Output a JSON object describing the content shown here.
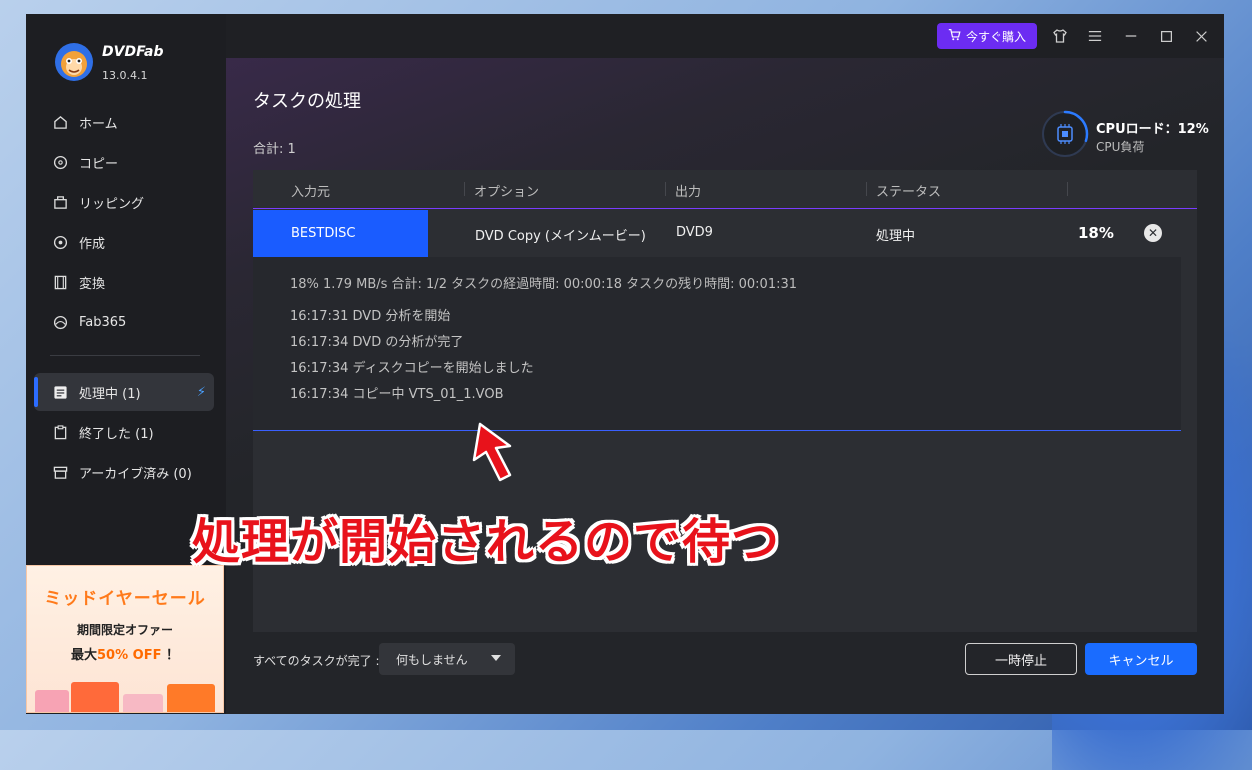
{
  "app": {
    "brand": "DVDFab",
    "version": "13.0.4.1"
  },
  "sidebar": {
    "items": [
      {
        "label": "ホーム",
        "icon": "home-icon"
      },
      {
        "label": "コピー",
        "icon": "copy-disc-icon"
      },
      {
        "label": "リッピング",
        "icon": "ripping-icon"
      },
      {
        "label": "作成",
        "icon": "create-disc-icon"
      },
      {
        "label": "変換",
        "icon": "film-icon"
      },
      {
        "label": "Fab365",
        "icon": "fab365-icon"
      }
    ],
    "queue": [
      {
        "label": "処理中 (1)",
        "icon": "task-list-icon",
        "active": true
      },
      {
        "label": "終了した (1)",
        "icon": "clipboard-icon",
        "active": false
      },
      {
        "label": "アーカイブ済み (0)",
        "icon": "archive-icon",
        "active": false
      }
    ]
  },
  "promo": {
    "title": "ミッドイヤーセール",
    "subtitle": "期間限定オファー",
    "offer_prefix": "最大",
    "offer_value": "50% OFF",
    "offer_suffix": "！"
  },
  "topbar": {
    "buy_label": "今すぐ購入"
  },
  "page": {
    "title": "タスクの処理",
    "total": "合計: 1"
  },
  "cpu": {
    "load_label": "CPUロード：12%",
    "sub_label": "CPU負荷",
    "load_fraction": 0.12,
    "accent": "#2c7bff"
  },
  "table": {
    "headers": [
      "入力元",
      "オプション",
      "出力",
      "ステータス"
    ],
    "row": {
      "source": "BESTDISC",
      "option": "DVD Copy (メインムービー)",
      "output": "DVD9",
      "status": "処理中",
      "percent": "18%"
    },
    "details": {
      "stats": "18%  1.79 MB/s   合計: 1/2  タスクの経過時間: 00:00:18  タスクの残り時間: 00:01:31",
      "log": [
        "16:17:31  DVD 分析を開始",
        "16:17:34  DVD の分析が完了",
        "16:17:34  ディスクコピーを開始しました",
        "16:17:34  コピー中 VTS_01_1.VOB"
      ]
    }
  },
  "footer": {
    "after_label": "すべてのタスクが完了 :",
    "after_value": "何もしません",
    "pause_label": "一時停止",
    "cancel_label": "キャンセル"
  },
  "annotation": {
    "text": "処理が開始されるので待つ"
  },
  "colors": {
    "accent_blue": "#1a6cff",
    "buy_purple": "#6c2cf2",
    "annotation_red": "#e8121b"
  }
}
